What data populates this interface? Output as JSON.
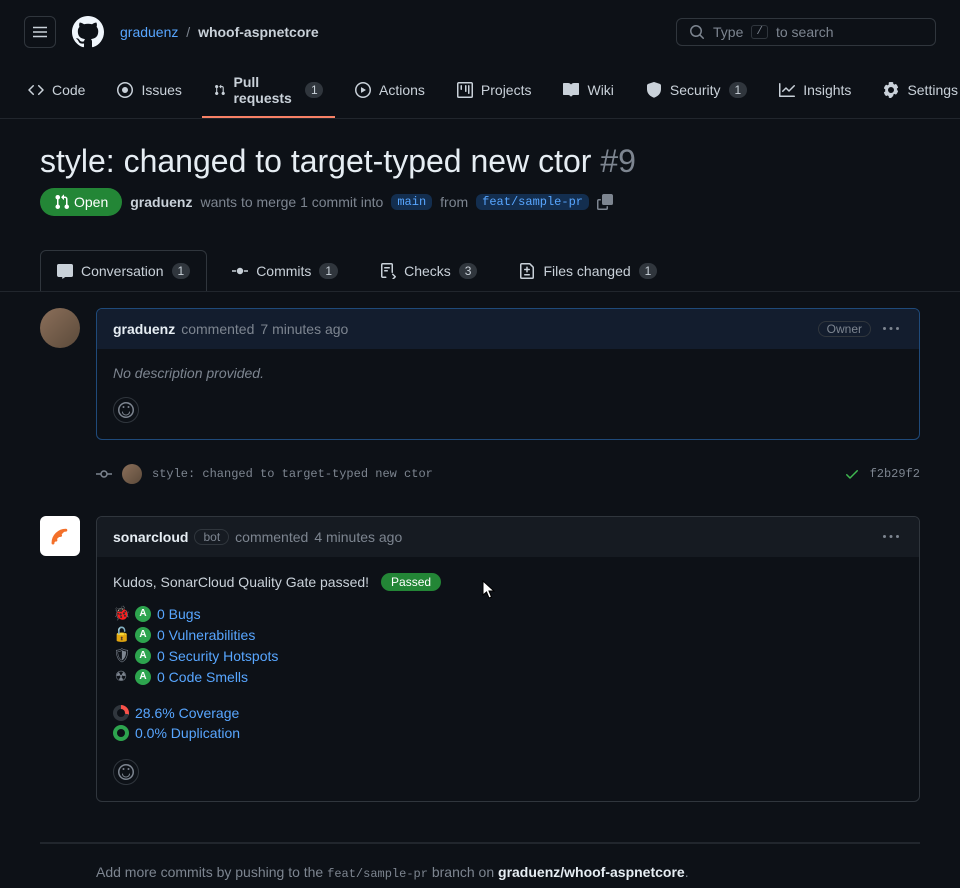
{
  "header": {
    "owner": "graduenz",
    "repo": "whoof-aspnetcore",
    "search_placeholder": "to search",
    "search_prefix": "Type",
    "search_key": "/"
  },
  "repo_nav": {
    "code": "Code",
    "issues": "Issues",
    "pulls": "Pull requests",
    "pulls_count": "1",
    "actions": "Actions",
    "projects": "Projects",
    "wiki": "Wiki",
    "security": "Security",
    "security_count": "1",
    "insights": "Insights",
    "settings": "Settings"
  },
  "pr": {
    "title": "style: changed to target-typed new ctor",
    "number": "#9",
    "state": "Open",
    "author": "graduenz",
    "merge_text_1": "wants to merge 1 commit into",
    "base_branch": "main",
    "merge_text_2": "from",
    "head_branch": "feat/sample-pr"
  },
  "tabs": {
    "conversation": "Conversation",
    "conversation_count": "1",
    "commits": "Commits",
    "commits_count": "1",
    "checks": "Checks",
    "checks_count": "3",
    "files": "Files changed",
    "files_count": "1"
  },
  "comment1": {
    "author": "graduenz",
    "action": "commented",
    "time": "7 minutes ago",
    "owner_label": "Owner",
    "body": "No description provided."
  },
  "commit": {
    "message": "style: changed to target-typed new ctor",
    "hash": "f2b29f2"
  },
  "comment2": {
    "author": "sonarcloud",
    "bot_label": "bot",
    "action": "commented",
    "time": "4 minutes ago",
    "kudos": "Kudos, SonarCloud Quality Gate passed!",
    "passed": "Passed",
    "bugs": "0 Bugs",
    "vulns": "0 Vulnerabilities",
    "hotspots": "0 Security Hotspots",
    "smells": "0 Code Smells",
    "coverage": "28.6% Coverage",
    "duplication": "0.0% Duplication",
    "grade": "A"
  },
  "push_hint": {
    "prefix": "Add more commits by pushing to the",
    "branch": "feat/sample-pr",
    "middle": "branch on",
    "repo": "graduenz/whoof-aspnetcore",
    "suffix": "."
  }
}
